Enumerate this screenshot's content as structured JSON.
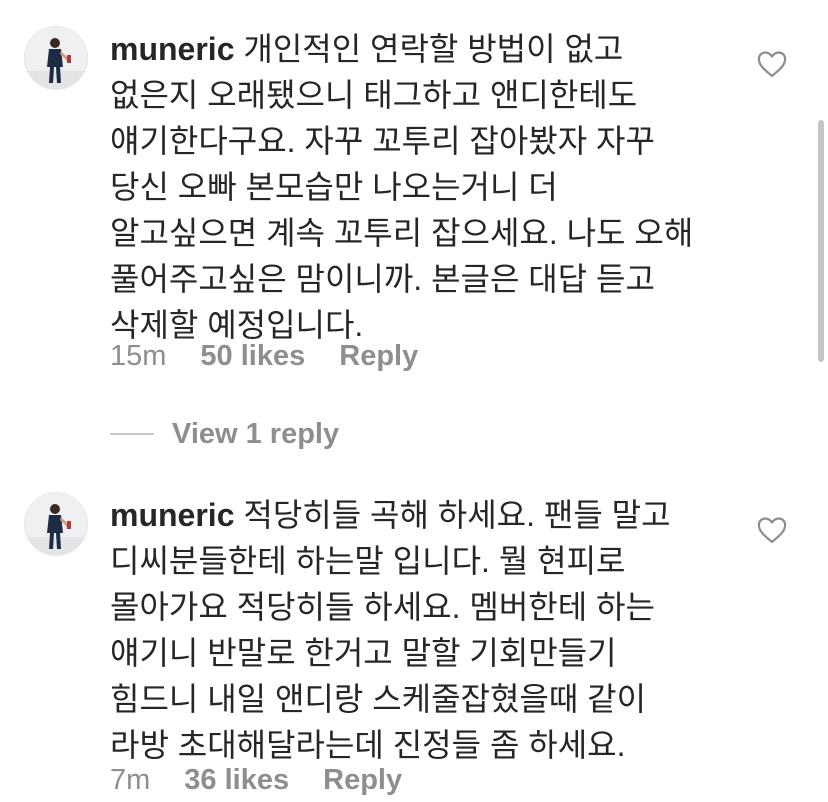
{
  "comments": [
    {
      "username": "muneric",
      "text": " 개인적인 연락할 방법이 없고 없은지 오래됐으니 태그하고 앤디한테도 얘기한다구요. 자꾸 꼬투리 잡아봤자 자꾸 당신 오빠 본모습만 나오는거니 더 알고싶으면 계속 꼬투리 잡으세요. 나도 오해 풀어주고싶은 맘이니까. 본글은 대답 듣고 삭제할 예정입니다.",
      "time": "15m",
      "likes": "50 likes",
      "reply": "Reply",
      "like_icon": "heart-outline-icon"
    },
    {
      "username": "muneric",
      "text": " 적당히들 곡해 하세요. 팬들 말고 디씨분들한테 하는말 입니다. 뭘 현피로 몰아가요 적당히들 하세요. 멤버한테 하는 얘기니 반말로 한거고 말할 기회만들기 힘드니 내일 앤디랑 스케줄잡혔을때 같이 라방 초대해달라는데 진정들 좀 하세요.",
      "time": "7m",
      "likes": "36 likes",
      "reply": "Reply",
      "like_icon": "heart-outline-icon"
    }
  ],
  "view_replies": "View 1 reply",
  "colors": {
    "text": "#262626",
    "secondary": "#8e8e8e",
    "divider": "#c7c7c7"
  }
}
